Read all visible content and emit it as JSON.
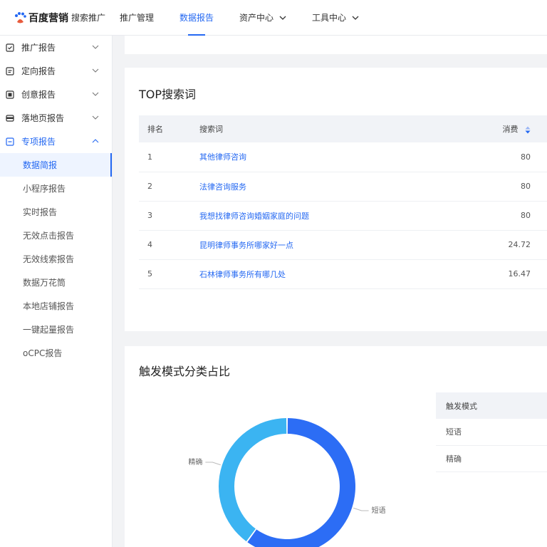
{
  "brand": {
    "name": "百度营销",
    "product": "搜索推广"
  },
  "nav": [
    {
      "label": "推广管理",
      "active": false,
      "dropdown": false
    },
    {
      "label": "数据报告",
      "active": true,
      "dropdown": false
    },
    {
      "label": "资产中心",
      "active": false,
      "dropdown": true
    },
    {
      "label": "工具中心",
      "active": false,
      "dropdown": true
    }
  ],
  "sidebar": {
    "groups": [
      {
        "label": "推广报告",
        "icon": "report-icon",
        "expanded": false
      },
      {
        "label": "定向报告",
        "icon": "target-icon",
        "expanded": false
      },
      {
        "label": "创意报告",
        "icon": "creative-icon",
        "expanded": false
      },
      {
        "label": "落地页报告",
        "icon": "landing-page-icon",
        "expanded": false
      },
      {
        "label": "专项报告",
        "icon": "special-report-icon",
        "expanded": true
      }
    ],
    "sub_items": [
      {
        "label": "数据简报",
        "active": true
      },
      {
        "label": "小程序报告",
        "active": false
      },
      {
        "label": "实时报告",
        "active": false
      },
      {
        "label": "无效点击报告",
        "active": false
      },
      {
        "label": "无效线索报告",
        "active": false
      },
      {
        "label": "数据万花筒",
        "active": false
      },
      {
        "label": "本地店铺报告",
        "active": false
      },
      {
        "label": "一键起量报告",
        "active": false
      },
      {
        "label": "oCPC报告",
        "active": false
      }
    ]
  },
  "top_search": {
    "title": "TOP搜索词",
    "columns": {
      "rank": "排名",
      "term": "搜索词",
      "cost": "消费"
    },
    "rows": [
      {
        "rank": "1",
        "term": "其他律师咨询",
        "cost": "80"
      },
      {
        "rank": "2",
        "term": "法律咨询服务",
        "cost": "80"
      },
      {
        "rank": "3",
        "term": "我想找律师咨询婚姻家庭的问题",
        "cost": "80"
      },
      {
        "rank": "4",
        "term": "昆明律师事务所哪家好一点",
        "cost": "24.72"
      },
      {
        "rank": "5",
        "term": "石林律师事务所有哪几处",
        "cost": "16.47"
      }
    ]
  },
  "trigger": {
    "title": "触发模式分类占比",
    "table_header": "触发模式",
    "table_rows": [
      "短语",
      "精确"
    ]
  },
  "chart_data": {
    "type": "pie",
    "donut": true,
    "slices": [
      {
        "label": "短语",
        "value": 60,
        "color": "#2c6df5"
      },
      {
        "label": "精确",
        "value": 40,
        "color": "#3bb4f2"
      }
    ],
    "title": "",
    "legend": "none"
  },
  "colors": {
    "accent": "#2468f2",
    "header_bg": "#f1f3f7"
  }
}
